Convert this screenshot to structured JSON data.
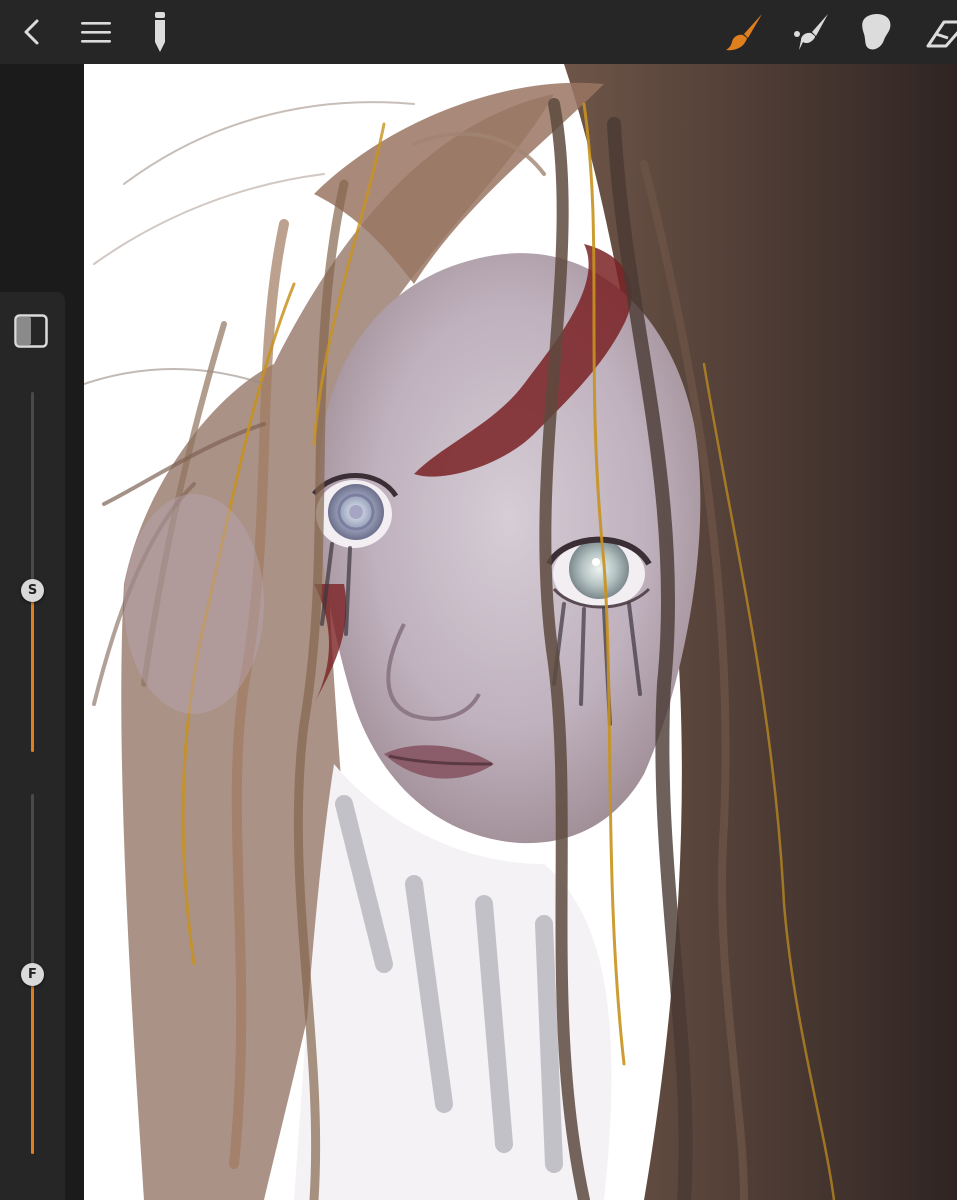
{
  "toolbar": {
    "icons": [
      "chevron-left-icon",
      "menu-icon",
      "pencil-icon",
      "brush-icon",
      "smudge-icon",
      "eraser-icon"
    ],
    "active_tool": "brush",
    "accent_color": "#e07f1f"
  },
  "sidebar": {
    "size_slider": {
      "label": "S",
      "value": 0.45
    },
    "opacity_slider": {
      "label": "F",
      "value": 0.5
    }
  },
  "canvas": {
    "background": "#ffffff"
  }
}
